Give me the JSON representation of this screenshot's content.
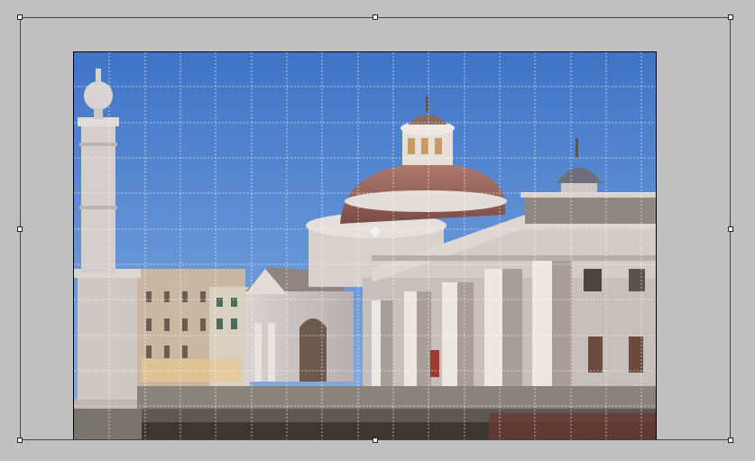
{
  "canvas": {
    "background_color": "#c0c0c0",
    "photo_subject": "domed-church-photo",
    "sky_color": "#4a7fc8",
    "grid_color": "#ffffff"
  },
  "transform": {
    "mode": "free-transform",
    "handles": [
      "top-left",
      "top-center",
      "top-right",
      "middle-left",
      "middle-right",
      "bottom-left",
      "bottom-center",
      "bottom-right"
    ],
    "reference_point": "center-point-icon"
  }
}
